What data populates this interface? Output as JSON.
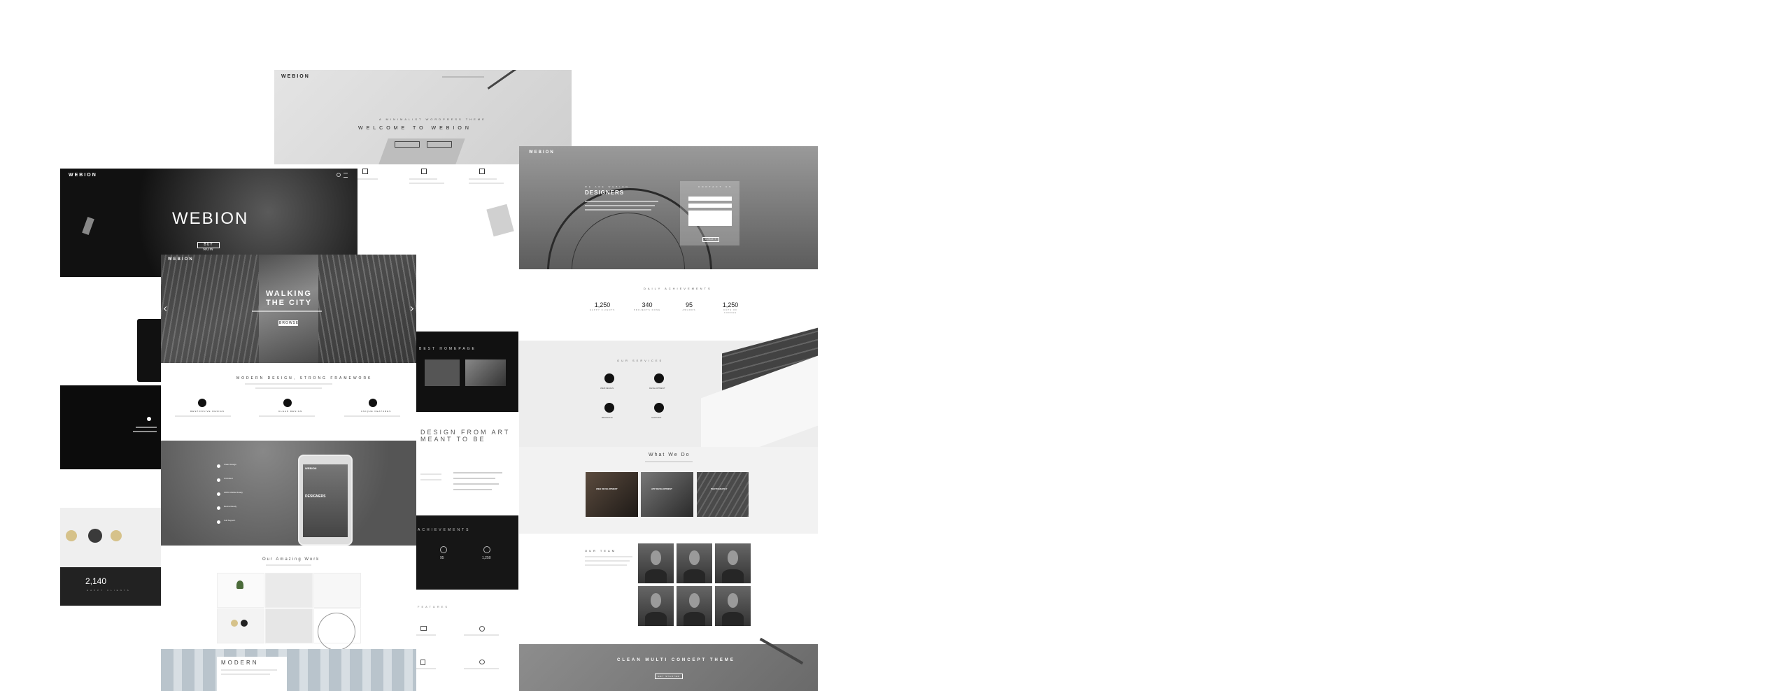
{
  "colors": {
    "dark": "#111111",
    "mid": "#6e6e6e",
    "light": "#f1f1f1",
    "accent": "#ffffff"
  },
  "shotA": {
    "logo": "WEBION",
    "tagline": "A MINIMALIST WORDPRESS THEME",
    "title": "WELCOME TO WEBION",
    "buttons": [
      "",
      ""
    ]
  },
  "shotB": {
    "logo": "WEBION",
    "title": "WEBION",
    "button": "BUY NOW",
    "counter": "2,140",
    "counter_label": "HAPPY CLIENTS"
  },
  "shotC": {
    "logo": "WEBION",
    "hero_title": "WALKING\nTHE CITY",
    "hero_button": "BROWSE",
    "section_title": "MODERN DESIGN, STRONG FRAMEWORK",
    "features": [
      "RESPONSIVE DESIGN",
      "CLEAN DESIGN",
      "UNIQUE FEATURES"
    ],
    "phone_logo": "WEBION",
    "phone_title": "DESIGNERS",
    "list": [
      "Clean Design",
      "Unlimited",
      "100% Mobile Ready",
      "Retina Ready",
      "Full Support"
    ],
    "work_title": "Our Amazing Work",
    "footer_title": "MODERN"
  },
  "shotD": {
    "logo": "WEBION",
    "hero_kicker": "WE ARE WEBION",
    "hero_title": "DESIGNERS",
    "form_title": "CONTACT US",
    "form_button": "SUBMIT",
    "achievements_title": "DAILY ACHIEVEMENTS",
    "stats": [
      {
        "n": "1,250",
        "l": "HAPPY CLIENTS"
      },
      {
        "n": "340",
        "l": "PROJECTS DONE"
      },
      {
        "n": "95",
        "l": "AWARDS"
      },
      {
        "n": "1,250",
        "l": "CUPS OF COFFEE"
      }
    ],
    "services_title": "OUR SERVICES",
    "services": [
      "WEB DESIGN",
      "DEVELOPMENT",
      "BRANDING",
      "SUPPORT"
    ],
    "whatwedo_title": "What We Do",
    "whatwedo_cards": [
      "WEB DEVELOPMENT",
      "APP DEVELOPMENT",
      "PHOTOGRAPHY"
    ],
    "team_title": "OUR TEAM",
    "cta_title": "CLEAN MULTI CONCEPT THEME",
    "cta_button": "GET STARTED"
  },
  "shotE": {
    "best_title": "BEST HOMEPAGE",
    "art_title": "DESIGN FROM ART\nMEANT TO BE",
    "achievements": "ACHIEVEMENTS",
    "stat1": "95",
    "stat2": "1,250",
    "features_title": "FEATURES"
  }
}
